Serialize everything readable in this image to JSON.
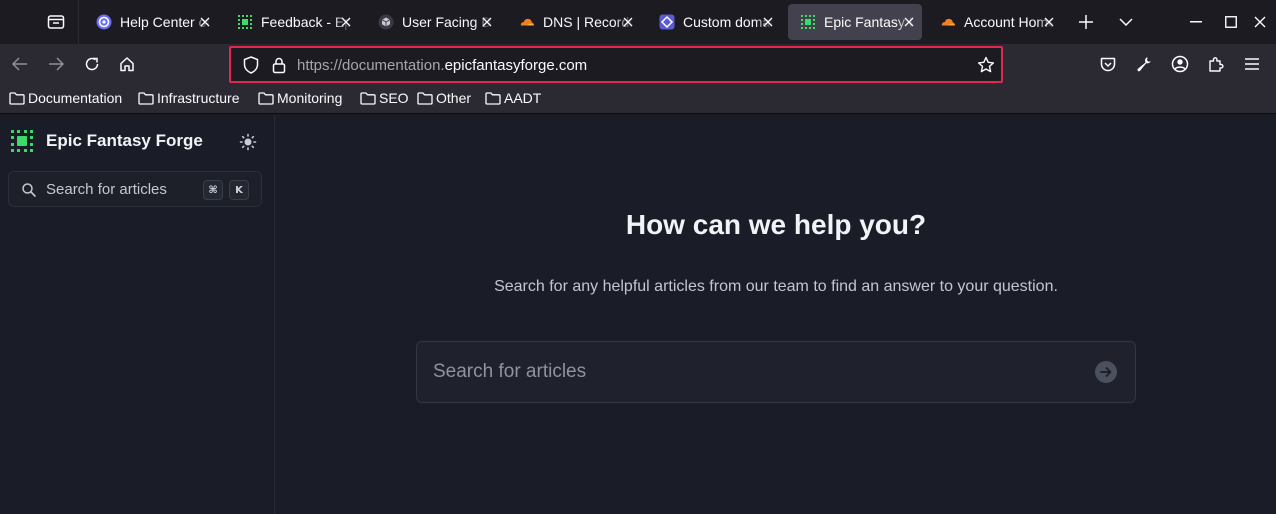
{
  "browser": {
    "tabs": [
      {
        "title": "Help Center of",
        "favicon": "blue-swirl-icon",
        "active": false
      },
      {
        "title": "Feedback - Epic",
        "favicon": "green-grid-icon",
        "active": false
      },
      {
        "title": "User Facing Docs",
        "favicon": "cube-icon",
        "active": false
      },
      {
        "title": "DNS | Records",
        "favicon": "cloud-icon",
        "active": false
      },
      {
        "title": "Custom domain",
        "favicon": "purple-diamond-icon",
        "active": false
      },
      {
        "title": "Epic Fantasy Forge",
        "favicon": "green-grid-icon",
        "active": true
      },
      {
        "title": "Account Home",
        "favicon": "cloud-icon",
        "active": false
      }
    ],
    "url": {
      "prefix": "https://documentation.",
      "domain": "epicfantasyforge.com"
    },
    "bookmarks": [
      "Documentation",
      "Infrastructure",
      "Monitoring",
      "SEO",
      "Other",
      "AADT"
    ],
    "accent_color": "#e22850"
  },
  "site": {
    "brand_name": "Epic Fantasy Forge",
    "sidebar_search": {
      "placeholder": "Search for articles",
      "shortcut_key1": "⌘",
      "shortcut_key2": "K"
    },
    "hero": {
      "title": "How can we help you?",
      "subtitle": "Search for any helpful articles from our team to find an answer to your question.",
      "search_placeholder": "Search for articles"
    }
  }
}
